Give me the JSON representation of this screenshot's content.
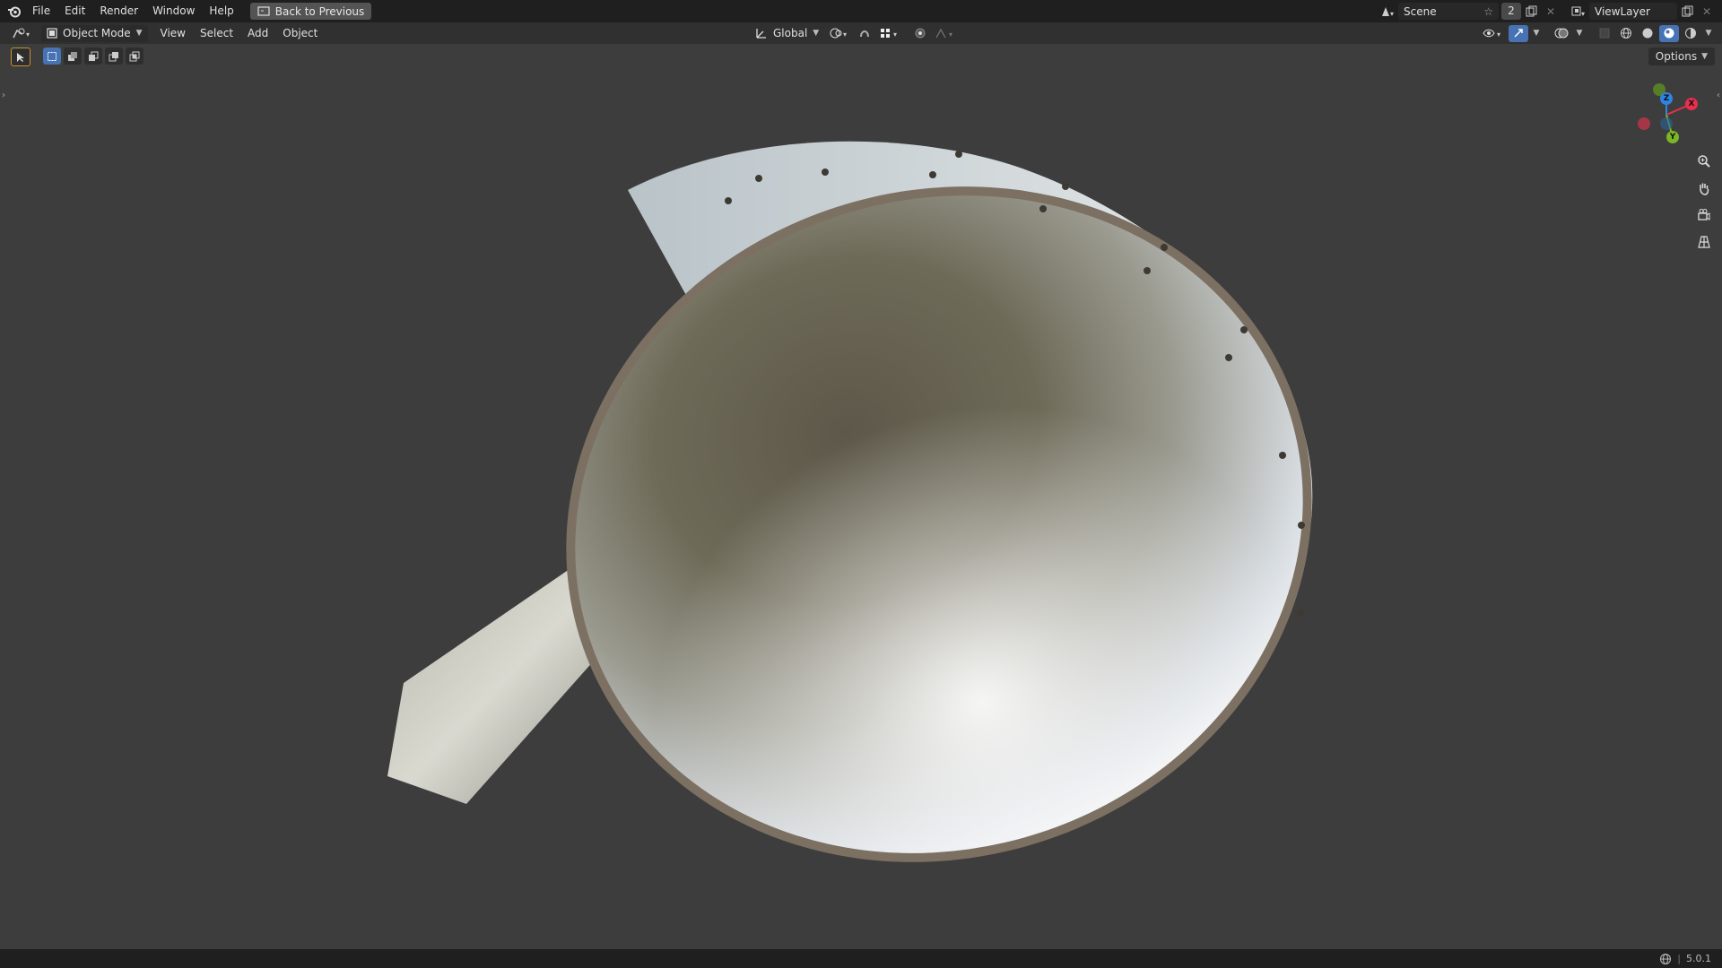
{
  "topbar": {
    "menus": [
      "File",
      "Edit",
      "Render",
      "Window",
      "Help"
    ],
    "back_button": "Back to Previous",
    "scene_name": "Scene",
    "scene_users": "2",
    "view_layer": "ViewLayer"
  },
  "header": {
    "mode": "Object Mode",
    "menus": [
      "View",
      "Select",
      "Add",
      "Object"
    ],
    "orientation": "Global",
    "options_label": "Options"
  },
  "gizmo": {
    "x_label": "X",
    "y_label": "Y",
    "z_label": "Z",
    "x_color": "#e8304e",
    "y_color": "#7ab727",
    "z_color": "#2f84e3"
  },
  "status": {
    "version": "5.0.1"
  },
  "colors": {
    "accent": "#4772b3",
    "viewport_bg": "#3d3d3d"
  }
}
